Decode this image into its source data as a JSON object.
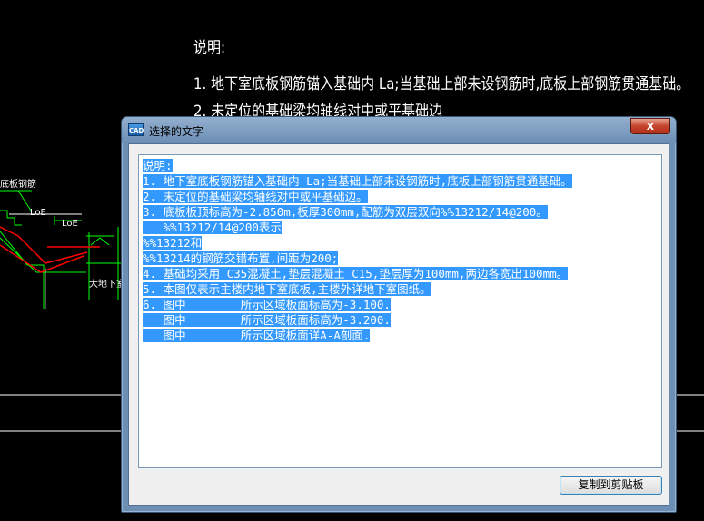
{
  "cad": {
    "note_lines": [
      "说明:",
      "1. 地下室底板钢筋锚入基础内 La;当基础上部未设钢筋时,底板上部钢筋贯通基础。",
      "2. 未定位的基础梁均轴线对中或平基础边"
    ],
    "labels": {
      "rebar": "底板钢筋",
      "loe1": "LoE",
      "loe2": "LoE",
      "bottom": "大地下室底"
    }
  },
  "dialog": {
    "title": "选择的文字",
    "app_icon_text": "CAD",
    "close_symbol": "x",
    "text_lines": [
      "说明:",
      "1. 地下室底板钢筋锚入基础内 La;当基础上部未设钢筋时,底板上部钢筋贯通基础。",
      "2. 未定位的基础梁均轴线对中或平基础边。",
      "3. 底板板顶标高为-2.850m,板厚300mm,配筋为双层双向%%13212/14@200。",
      "   %%13212/14@200表示",
      "%%13212和",
      "%%13214的钢筋交错布置,间距为200;",
      "4. 基础均采用 C35混凝土,垫层混凝土 C15,垫层厚为100mm,两边各宽出100mm。",
      "5. 本图仅表示主楼内地下室底板,主楼外详地下室图纸。",
      "6. 图中        所示区域板面标高为-3.100.",
      "   图中        所示区域板面标高为-3.200.",
      "   图中        所示区域板面详A-A剖面."
    ],
    "copy_button": "复制到剪贴板"
  },
  "colors": {
    "selection": "#3399ff",
    "cad_background": "#000000",
    "cad_green": "#00ff00",
    "cad_red": "#ff0000"
  }
}
